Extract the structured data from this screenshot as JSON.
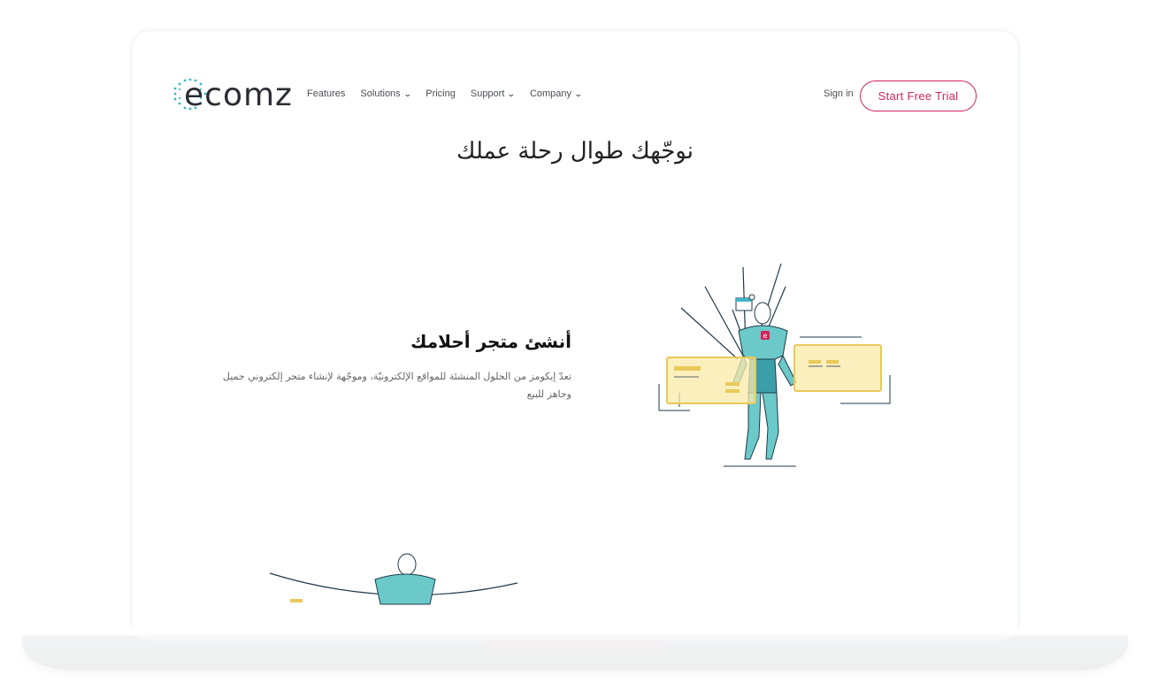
{
  "brand": {
    "logo_text": "ecomz",
    "accent": "#d3245b",
    "logo_dot_color": "#3bb6c8"
  },
  "nav": {
    "items": [
      {
        "label": "Features",
        "has_dropdown": false
      },
      {
        "label": "Solutions",
        "has_dropdown": true
      },
      {
        "label": "Pricing",
        "has_dropdown": false
      },
      {
        "label": "Support",
        "has_dropdown": true
      },
      {
        "label": "Company",
        "has_dropdown": true
      }
    ],
    "sign_in": "Sign in",
    "cta": "Start Free Trial"
  },
  "hero": {
    "title": "نوجّهك طوال رحلة عملك"
  },
  "feature": {
    "title": "أنشئ متجر أحلامك",
    "description": "تعدّ إيكومز من الحلول المنشئة للمواقع الإلكترونيّة، وموجّهة لإنشاء متجر إلكتروني جميل وجاهز للبيع"
  },
  "icons": {
    "dropdown": "chevron-down-icon"
  }
}
